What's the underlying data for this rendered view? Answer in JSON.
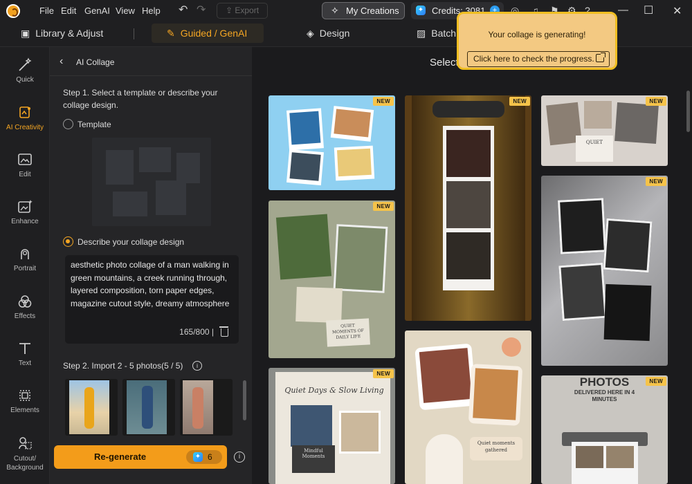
{
  "menu": [
    "File",
    "Edit",
    "GenAI",
    "View",
    "Help"
  ],
  "toolbar": {
    "export_label": "Export",
    "my_creations_label": "My Creations",
    "credits_label": "Credits: 3081"
  },
  "tabs": {
    "library": "Library & Adjust",
    "guided": "Guided / GenAI",
    "design": "Design",
    "batch": "Batch"
  },
  "rail": [
    "Quick",
    "AI Creativity",
    "Edit",
    "Enhance",
    "Portrait",
    "Effects",
    "Text",
    "Elements",
    "Cutout/\nBackground"
  ],
  "panel": {
    "title": "AI Collage",
    "step1": "Step 1. Select a template or describe your collage design.",
    "template_option": "Template",
    "describe_option": "Describe your collage design",
    "description": "aesthetic photo collage of a man walking in green mountains, a creek running through, layered composition, torn paper edges, magazine cutout style, dreamy atmosphere",
    "char_count": "165/800 |",
    "step2": "Step 2. Import 2 - 5 photos(5 / 5)",
    "regenerate_label": "Re-generate",
    "regenerate_cost": "6"
  },
  "main": {
    "title": "Select",
    "new_badge": "NEW"
  },
  "card_text": {
    "quiet_moments": "QUIET MOMENTS OF DAILY LIFE",
    "quiet": "QUIET",
    "slow_living": "Quiet Days & Slow Living",
    "mindful": "Mindful Moments",
    "quiet_moments_gathered": "Quiet moments gathered",
    "photos": "PHOTOS",
    "delivered": "DELIVERED HERE IN 4 MINUTES"
  },
  "toast": {
    "message": "Your collage is generating!",
    "action": "Click here to check the progress."
  },
  "colors": {
    "accent": "#f5a623",
    "toast_bg": "#f3c982",
    "toast_border": "#f0be21",
    "regen_bg": "#f39c1a"
  }
}
